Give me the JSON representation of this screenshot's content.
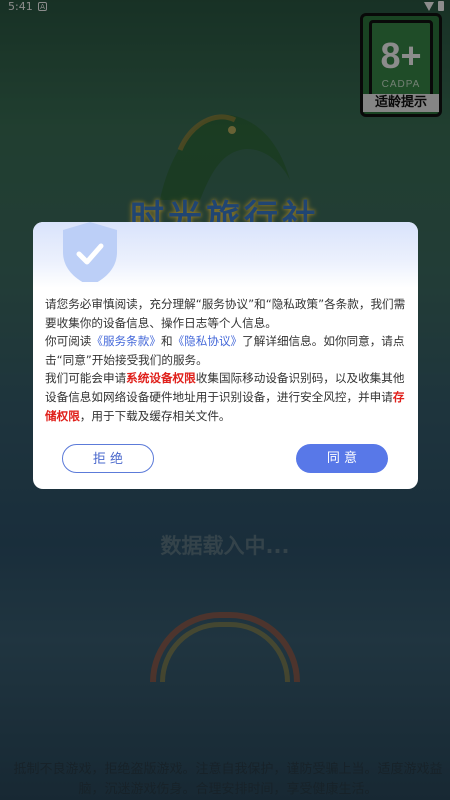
{
  "status_bar": {
    "time": "5:41",
    "app_icon": "A"
  },
  "age_rating": {
    "number": "8+",
    "org": "CADPA",
    "label": "适龄提示"
  },
  "game_title": "时光旅行社",
  "dialog": {
    "paragraph1": "请您务必审慎阅读，充分理解“服务协议”和“隐私政策”各条款，我们需要收集你的设备信息、操作日志等个人信息。",
    "p2_pre": "你可阅读",
    "p2_link1": "《服务条款》",
    "p2_mid": "和",
    "p2_link2": "《隐私协议》",
    "p2_post": "了解详细信息。如你同意，请点击“同意”开始接受我们的服务。",
    "p3_pre": "我们可能会申请",
    "p3_perm1": "系统设备权限",
    "p3_mid": "收集国际移动设备识别码，以及收集其他设备信息如网络设备硬件地址用于识别设备，进行安全风控，并申请",
    "p3_perm2": "存储权限",
    "p3_post": "，用于下载及缓存相关文件。",
    "refuse_label": "拒 绝",
    "agree_label": "同 意"
  },
  "loading_text": "数据载入中...",
  "notice": "抵制不良游戏，拒绝盗版游戏。注意自我保护，谨防受骗上当。适度游戏益脑，沉迷游戏伤身。合理安排时间，享受健康生活。",
  "colors": {
    "link": "#4468d9",
    "permission": "#e0201b",
    "agree_button": "#5878e8"
  }
}
